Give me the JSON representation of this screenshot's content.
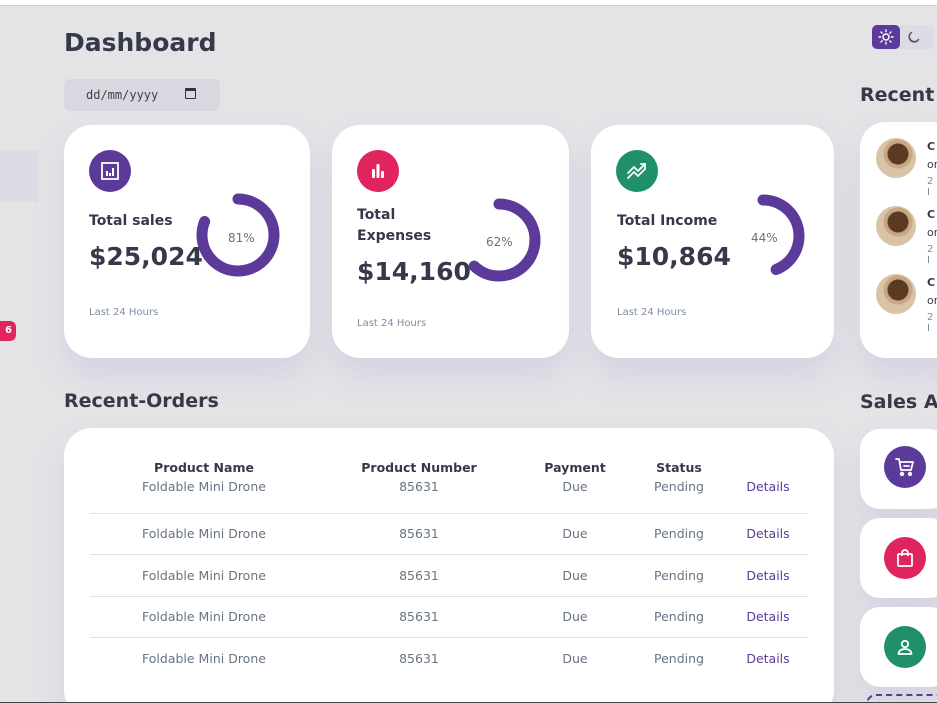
{
  "header": {
    "title": "Dashboard"
  },
  "date_input": {
    "placeholder": "dd/mm/yyyy"
  },
  "sidebar": {
    "badge_count": "6"
  },
  "colors": {
    "primary": "#5b3a99",
    "danger": "#e0245e",
    "success": "#1f8f6c",
    "background": "#e4e4e7"
  },
  "insights": [
    {
      "title": "Total sales",
      "amount": "$25,024",
      "percent_label": "81%",
      "percent": 81,
      "caption": "Last 24 Hours",
      "icon": "analytics-icon",
      "color": "#5b3a99"
    },
    {
      "title": "Total Expenses",
      "title_line1": "Total",
      "title_line2": "Expenses",
      "amount": "$14,160",
      "percent_label": "62%",
      "percent": 62,
      "caption": "Last 24 Hours",
      "icon": "bar-chart-icon",
      "color": "#e0245e"
    },
    {
      "title": "Total Income",
      "amount": "$10,864",
      "percent_label": "44%",
      "percent": 44,
      "caption": "Last 24 Hours",
      "icon": "trending-up-icon",
      "color": "#1f8f6c"
    }
  ],
  "recent_orders": {
    "title": "Recent-Orders",
    "columns": [
      "Product Name",
      "Product Number",
      "Payment",
      "Status"
    ],
    "rows": [
      {
        "name": "Foldable Mini Drone",
        "number": "85631",
        "payment": "Due",
        "status": "Pending",
        "action": "Details"
      },
      {
        "name": "Foldable Mini Drone",
        "number": "85631",
        "payment": "Due",
        "status": "Pending",
        "action": "Details"
      },
      {
        "name": "Foldable Mini Drone",
        "number": "85631",
        "payment": "Due",
        "status": "Pending",
        "action": "Details"
      },
      {
        "name": "Foldable Mini Drone",
        "number": "85631",
        "payment": "Due",
        "status": "Pending",
        "action": "Details"
      },
      {
        "name": "Foldable Mini Drone",
        "number": "85631",
        "payment": "Due",
        "status": "Pending",
        "action": "Details"
      }
    ]
  },
  "recent_updates": {
    "title": "Recent U",
    "items": [
      {
        "l1": "C",
        "l2": "or",
        "l3": "2 I"
      },
      {
        "l1": "C",
        "l2": "or",
        "l3": "2 I"
      },
      {
        "l1": "C",
        "l2": "or",
        "l3": "2 I"
      }
    ]
  },
  "sales_analytics": {
    "title": "Sales An",
    "items": [
      {
        "icon": "shopping-cart-icon",
        "color": "#5b3a99"
      },
      {
        "icon": "shopping-bag-icon",
        "color": "#e0245e"
      },
      {
        "icon": "person-icon",
        "color": "#1f8f6c"
      }
    ]
  }
}
